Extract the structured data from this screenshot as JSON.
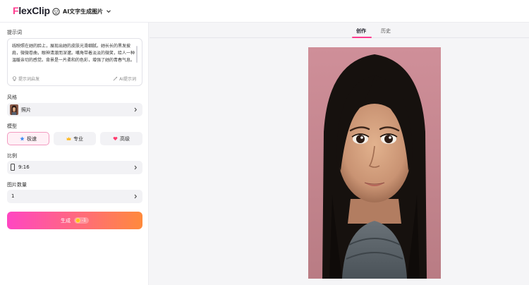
{
  "header": {
    "logo": {
      "prefix": "F",
      "rest": "lexClip"
    },
    "tool_label": "AI文字生成图片"
  },
  "sidebar": {
    "prompt": {
      "label": "提示词",
      "text": "线映照在她的脸上，展现出她的皮肤光滑细腻。她长长的黑发披肩，微微卷曲，眼神清澈而深邃。嘴角带着淡淡的微笑，给人一种温暖亲切的感觉。背景是一片柔和的色彩，增强了她的青春气息。",
      "inspire_label": "提示词启发",
      "ai_label": "AI提示词"
    },
    "style": {
      "label": "风格",
      "value": "照片"
    },
    "model": {
      "label": "模型",
      "options": [
        "极速",
        "专业",
        "高级"
      ],
      "selected": "极速"
    },
    "ratio": {
      "label": "比例",
      "value": "9:16"
    },
    "count": {
      "label": "图片数量",
      "value": "1"
    },
    "generate": {
      "label": "生成",
      "cost": "-1"
    }
  },
  "main": {
    "tabs": [
      "创作",
      "历史"
    ],
    "active_tab": "创作"
  },
  "colors": {
    "accent": "#ff3c8f",
    "generate_gradient_start": "#ff46c2",
    "generate_gradient_end": "#ff8a3c",
    "image_background": "#c98a92"
  },
  "icons": {
    "tool_picker": "ai-image-icon",
    "inspire": "lightbulb-icon",
    "ai_prompt": "magic-wand-icon",
    "model_fast": "star-icon",
    "model_pro": "crown-icon",
    "model_advanced": "heart-icon",
    "ratio": "phone-portrait-icon",
    "coin": "coin-icon"
  }
}
